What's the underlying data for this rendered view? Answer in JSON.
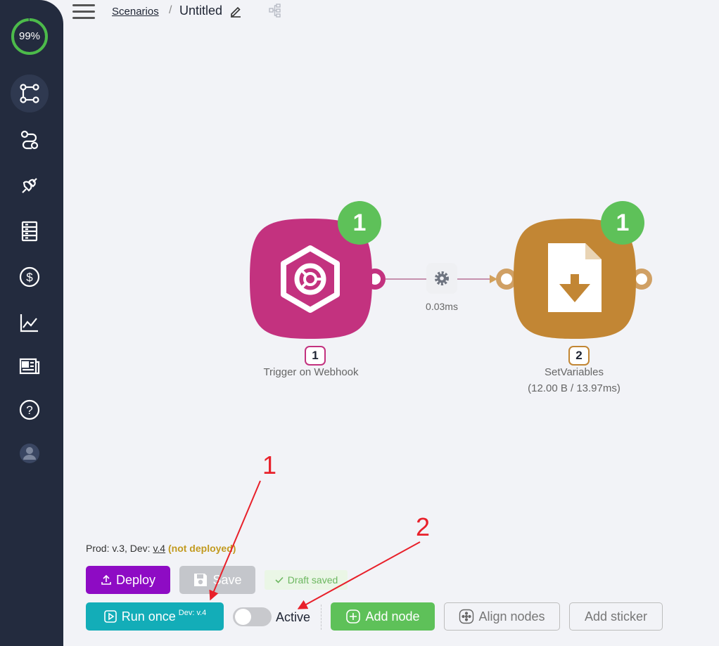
{
  "sidebar": {
    "progress": "99%",
    "progress_fraction": 0.99,
    "items": [
      {
        "name": "scenarios-icon",
        "active": true
      },
      {
        "name": "flows-icon",
        "active": false
      },
      {
        "name": "connections-icon",
        "active": false
      },
      {
        "name": "storage-icon",
        "active": false
      },
      {
        "name": "billing-icon",
        "active": false
      },
      {
        "name": "analytics-icon",
        "active": false
      },
      {
        "name": "news-icon",
        "active": false
      },
      {
        "name": "help-icon",
        "active": false
      },
      {
        "name": "user-avatar-icon",
        "active": false
      }
    ]
  },
  "breadcrumb": {
    "parent": "Scenarios",
    "separator": "/",
    "title": "Untitled"
  },
  "nodes": [
    {
      "index": "1",
      "label": "Trigger on Webhook",
      "sublabel": "",
      "runs": "1",
      "color": "#c3327f"
    },
    {
      "index": "2",
      "label": "SetVariables",
      "sublabel": "(12.00 B / 13.97ms)",
      "runs": "1",
      "color": "#c28634"
    }
  ],
  "edge": {
    "timing": "0.03ms"
  },
  "status": {
    "prod_prefix": "Prod: v.3, Dev: ",
    "dev_version": "v.4",
    "warning": "(not deployed)"
  },
  "toolbar": {
    "deploy": "Deploy",
    "save": "Save",
    "draft": "Draft saved",
    "run_once": "Run once",
    "run_version": "Dev: v.4",
    "active": "Active",
    "active_on": false,
    "add_node": "Add node",
    "align_nodes": "Align nodes",
    "add_sticker": "Add sticker"
  },
  "annotations": [
    {
      "label": "1"
    },
    {
      "label": "2"
    }
  ],
  "colors": {
    "sidebar": "#232b3e",
    "deploy": "#8e0bc4",
    "run": "#13adb8",
    "add_node": "#5ec159",
    "annotation": "#e8202a"
  }
}
